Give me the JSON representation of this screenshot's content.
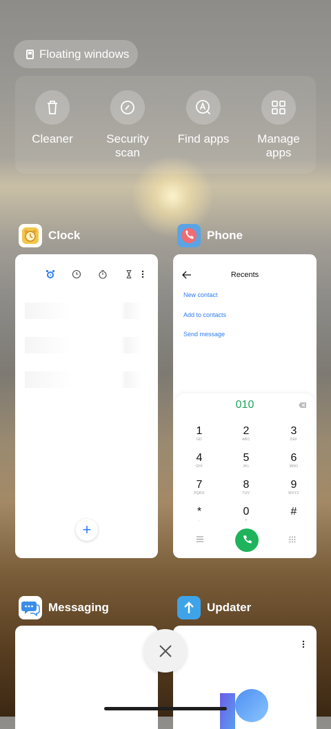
{
  "floating_windows": {
    "label": "Floating windows"
  },
  "quick_actions": [
    {
      "label": "Cleaner",
      "icon": "trash-icon"
    },
    {
      "label": "Security\nscan",
      "icon": "security-icon"
    },
    {
      "label": "Find apps",
      "icon": "find-apps-icon"
    },
    {
      "label": "Manage\napps",
      "icon": "grid-icon"
    }
  ],
  "apps": {
    "clock": {
      "name": "Clock"
    },
    "phone": {
      "name": "Phone",
      "title": "Recents",
      "links": [
        "New contact",
        "Add to contacts",
        "Send message"
      ],
      "dialed": "010",
      "keys": [
        {
          "n": "1",
          "l": "GD"
        },
        {
          "n": "2",
          "l": "ABC"
        },
        {
          "n": "3",
          "l": "DEF"
        },
        {
          "n": "4",
          "l": "GHI"
        },
        {
          "n": "5",
          "l": "JKL"
        },
        {
          "n": "6",
          "l": "MNO"
        },
        {
          "n": "7",
          "l": "PQRS"
        },
        {
          "n": "8",
          "l": "TUV"
        },
        {
          "n": "9",
          "l": "WXYZ"
        },
        {
          "n": "*",
          "l": ","
        },
        {
          "n": "0",
          "l": "+"
        },
        {
          "n": "#",
          "l": ""
        }
      ]
    },
    "messaging": {
      "name": "Messaging"
    },
    "updater": {
      "name": "Updater"
    }
  },
  "colors": {
    "accent_blue": "#2e7cf6",
    "call_green": "#1fb35c",
    "dial_green": "#1fa35a"
  }
}
